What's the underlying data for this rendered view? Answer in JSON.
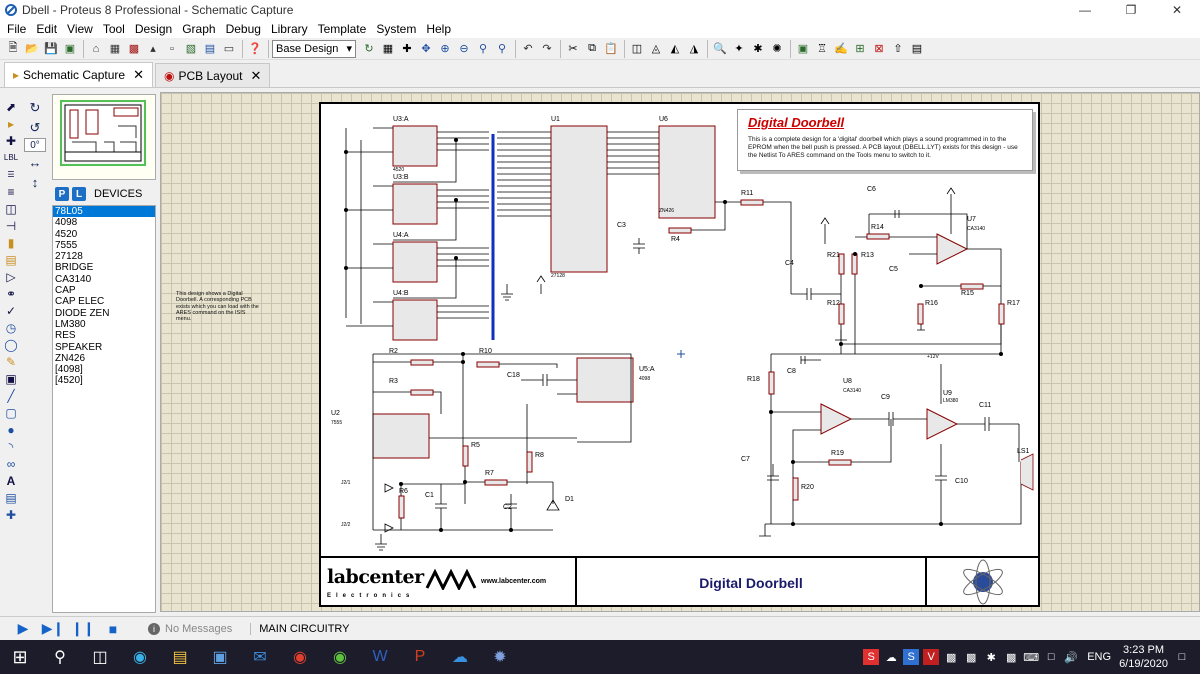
{
  "window": {
    "title": "Dbell - Proteus 8 Professional - Schematic Capture"
  },
  "menu": [
    "File",
    "Edit",
    "View",
    "Tool",
    "Design",
    "Graph",
    "Debug",
    "Library",
    "Template",
    "System",
    "Help"
  ],
  "toolbar": {
    "design_combo": "Base Design"
  },
  "tabs": [
    {
      "label": "Schematic Capture",
      "active": true
    },
    {
      "label": "PCB Layout",
      "active": false
    }
  ],
  "tools": {
    "rotation": "0°"
  },
  "devices": {
    "header": "DEVICES",
    "p_label": "P",
    "l_label": "L",
    "items": [
      "78L05",
      "4098",
      "4520",
      "7555",
      "27128",
      "BRIDGE",
      "CA3140",
      "CAP",
      "CAP ELEC",
      "DIODE ZEN",
      "LM380",
      "RES",
      "SPEAKER",
      "ZN426",
      "[4098]",
      "[4520]"
    ],
    "selected": "78L05"
  },
  "schematic": {
    "title_heading": "Digital Doorbell",
    "title_text": "This is a complete design for a 'digital' doorbell which plays a sound programmed in to the EPROM when the bell push is pressed. A PCB layout (DBELL.LYT) exists for this design - use the Netlist To ARES command on the Tools menu to switch to it.",
    "side_note": "This design shows a Digital Doorbell. A corresponding PCB exists which you can load with the ARES command on the ISIS menu.",
    "footer_company": "labcenter",
    "footer_company_sub": "Electronics",
    "footer_url": "www.labcenter.com",
    "footer_title": "Digital Doorbell",
    "components": {
      "u3a": "U3:A",
      "u3b": "U3:B",
      "u4a": "U4:A",
      "u4b": "U4:B",
      "u1": "U1",
      "u6": "U6",
      "u7": "U7",
      "u8": "U8",
      "u9": "U9",
      "u5a": "U5:A",
      "u2": "U2",
      "r2": "R2",
      "r3": "R3",
      "r4": "R4",
      "r5": "R5",
      "r6": "R6",
      "r7": "R7",
      "r8": "R8",
      "r10": "R10",
      "r11": "R11",
      "r12": "R12",
      "r13": "R13",
      "r14": "R14",
      "r15": "R15",
      "r16": "R16",
      "r17": "R17",
      "r18": "R18",
      "r19": "R19",
      "r20": "R20",
      "r21": "R21",
      "c1": "C1",
      "c2": "C2",
      "c3": "C3",
      "c4": "C4",
      "c5": "C5",
      "c6": "C6",
      "c7": "C7",
      "c8": "C8",
      "c9": "C9",
      "c10": "C10",
      "c11": "C11",
      "c18": "C18",
      "d1": "D1",
      "ls1": "LS1",
      "j1": "J2/1",
      "j2": "J2/2",
      "u3a_part": "4520",
      "u1_part": "27128",
      "u6_part": "ZN426",
      "u7_part": "CA3140",
      "u8_part": "CA3140",
      "u9_part": "LM380",
      "u5_part": "4098",
      "u2_part": "7555",
      "plus12": "+12V"
    }
  },
  "status": {
    "messages": "No Messages",
    "sheet": "MAIN CIRCUITRY"
  },
  "taskbar": {
    "lang": "ENG",
    "time": "3:23 PM",
    "date": "6/19/2020"
  }
}
